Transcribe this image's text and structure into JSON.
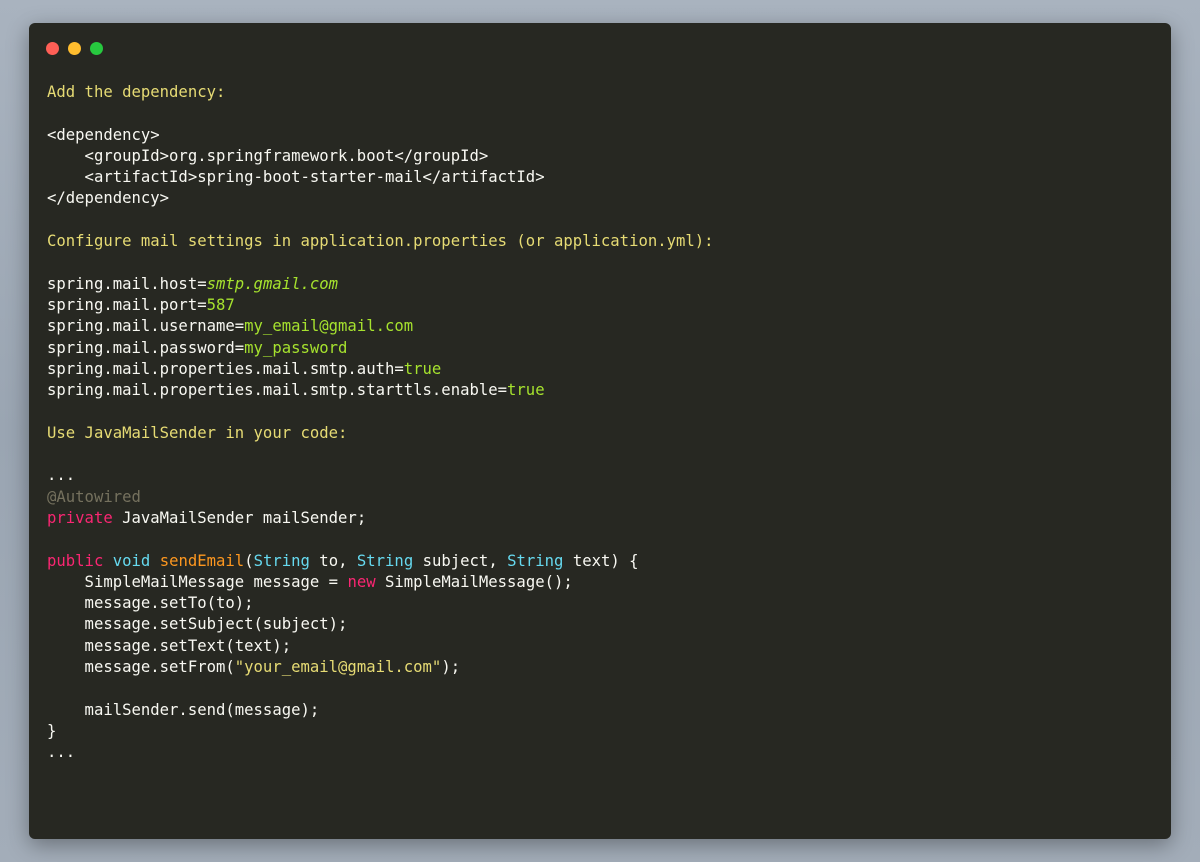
{
  "window": {
    "controls": [
      "close",
      "minimize",
      "zoom"
    ]
  },
  "code": {
    "heading1": "Add the dependency:",
    "dep_open": "<dependency>",
    "dep_group": "    <groupId>org.springframework.boot</groupId>",
    "dep_artifact": "    <artifactId>spring-boot-starter-mail</artifactId>",
    "dep_close": "</dependency>",
    "heading2": "Configure mail settings in application.properties (or application.yml):",
    "props": [
      {
        "key": "spring.mail.host=",
        "value": "smtp.gmail.com"
      },
      {
        "key": "spring.mail.port=",
        "value": "587"
      },
      {
        "key": "spring.mail.username=",
        "value": "my_email@gmail.com"
      },
      {
        "key": "spring.mail.password=",
        "value": "my_password"
      },
      {
        "key": "spring.mail.properties.mail.smtp.auth=",
        "value": "true"
      },
      {
        "key": "spring.mail.properties.mail.smtp.starttls.enable=",
        "value": "true"
      }
    ],
    "heading3": "Use JavaMailSender in your code:",
    "ellipsis": "...",
    "annotation": "@Autowired",
    "kw_private": "private",
    "field_rest": " JavaMailSender mailSender;",
    "kw_public": "public",
    "kw_void": "void",
    "method_name": "sendEmail",
    "type_string": "String",
    "param_to": " to, ",
    "param_subject": " subject, ",
    "param_text": " text) {",
    "body_msg_decl": "    SimpleMailMessage message = ",
    "kw_new": "new",
    "body_msg_ctor": " SimpleMailMessage();",
    "body_set_to": "    message.setTo(to);",
    "body_set_subject": "    message.setSubject(subject);",
    "body_set_text": "    message.setText(text);",
    "body_set_from_pre": "    message.setFrom(",
    "body_set_from_str": "\"your_email@gmail.com\"",
    "body_set_from_post": ");",
    "body_send": "    mailSender.send(message);",
    "close_brace": "}"
  },
  "colors": {
    "background": "#272822",
    "heading": "#e6db74",
    "value": "#a6e22e",
    "keyword": "#f92672",
    "type": "#66d9ef",
    "function": "#fd971f",
    "annotation": "#75715e"
  }
}
